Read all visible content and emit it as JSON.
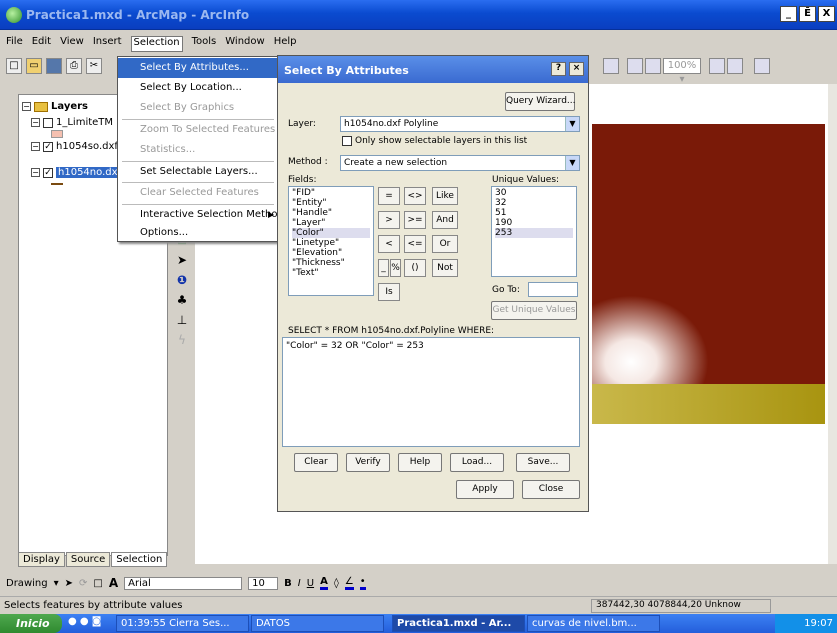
{
  "app": {
    "title": "Practica1.mxd - ArcMap - ArcInfo",
    "window_buttons": [
      "_",
      "Ē",
      "X"
    ]
  },
  "menubar": [
    "File",
    "Edit",
    "View",
    "Insert",
    "Selection",
    "Tools",
    "Window",
    "Help"
  ],
  "toc": {
    "layers_label": "Layers",
    "items": [
      "1_LimiteTM",
      "h1054so.dxf",
      "h1054no.dxf"
    ],
    "tabs": [
      "Display",
      "Source",
      "Selection"
    ]
  },
  "selection_menu": {
    "items": [
      {
        "label": "Select By Attributes...",
        "state": "highlighted"
      },
      {
        "label": "Select By Location...",
        "state": "enabled"
      },
      {
        "label": "Select By Graphics",
        "state": "disabled"
      },
      {
        "label": "Zoom To Selected Features",
        "state": "disabled"
      },
      {
        "label": "Statistics...",
        "state": "disabled"
      },
      {
        "label": "Set Selectable Layers...",
        "state": "enabled"
      },
      {
        "label": "Clear Selected Features",
        "state": "disabled"
      },
      {
        "label": "Interactive Selection Method",
        "state": "enabled"
      },
      {
        "label": "Options...",
        "state": "enabled"
      }
    ]
  },
  "dialog": {
    "title": "Select By Attributes",
    "query_wizard": "Query Wizard...",
    "layer_label": "Layer:",
    "layer_value": "h1054no.dxf Polyline",
    "only_selectable": "Only show selectable layers in this list",
    "method_label": "Method :",
    "method_value": "Create a new selection",
    "fields_label": "Fields:",
    "fields": [
      "\"FID\"",
      "\"Entity\"",
      "\"Handle\"",
      "\"Layer\"",
      "\"Color\"",
      "\"Linetype\"",
      "\"Elevation\"",
      "\"Thickness\"",
      "\"Text\""
    ],
    "operators": [
      "=",
      "<>",
      "Like",
      ">",
      ">=",
      "And",
      "<",
      "<=",
      "Or",
      "_",
      "%",
      "()",
      "Not",
      "Is"
    ],
    "unique_label": "Unique Values:",
    "unique_values": [
      "30",
      "32",
      "51",
      "190",
      "253"
    ],
    "goto_label": "Go To:",
    "get_unique": "Get Unique Values",
    "sql_label": "SELECT * FROM h1054no.dxf.Polyline WHERE:",
    "sql_text": "\"Color\" = 32 OR \"Color\" = 253",
    "buttons": [
      "Clear",
      "Verify",
      "Help",
      "Load...",
      "Save..."
    ],
    "apply": "Apply",
    "close": "Close"
  },
  "drawing": {
    "label": "Drawing",
    "font": "Arial",
    "size": "10"
  },
  "status": {
    "message": "Selects features by attribute values",
    "coords": "387442,30  4078844,20 Unknow"
  },
  "taskbar": {
    "start": "Inicio",
    "buttons": [
      "01:39:55 Cierra Ses...",
      "DATOS",
      "Practica1.mxd - Ar...",
      "curvas de nivel.bm..."
    ],
    "clock": "19:07"
  },
  "colors": {
    "title_blue": "#0a4bd0",
    "menu_highlight": "#3169c6",
    "map_dark_red": "#7a1a08",
    "map_olive": "#b5a51e"
  }
}
